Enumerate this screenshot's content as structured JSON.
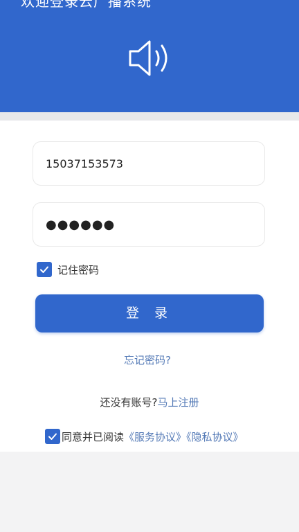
{
  "header": {
    "title": "欢迎登录云广播系统",
    "icon": "speaker-icon"
  },
  "login": {
    "phone_value": "15037153573",
    "password_value": "●●●●●●",
    "remember_label": "记住密码",
    "remember_checked": true,
    "login_button": "登 录",
    "forgot_password": "忘记密码?",
    "no_account_text": "还没有账号?",
    "register_link": "马上注册",
    "agree_checked": true,
    "agree_text": "同意并已阅读",
    "service_agreement": "《服务协议》",
    "privacy_agreement": "《隐私协议》"
  },
  "colors": {
    "brand_blue": "#3167cc",
    "link_blue": "#5379b6",
    "background": "#f3f3f4"
  }
}
